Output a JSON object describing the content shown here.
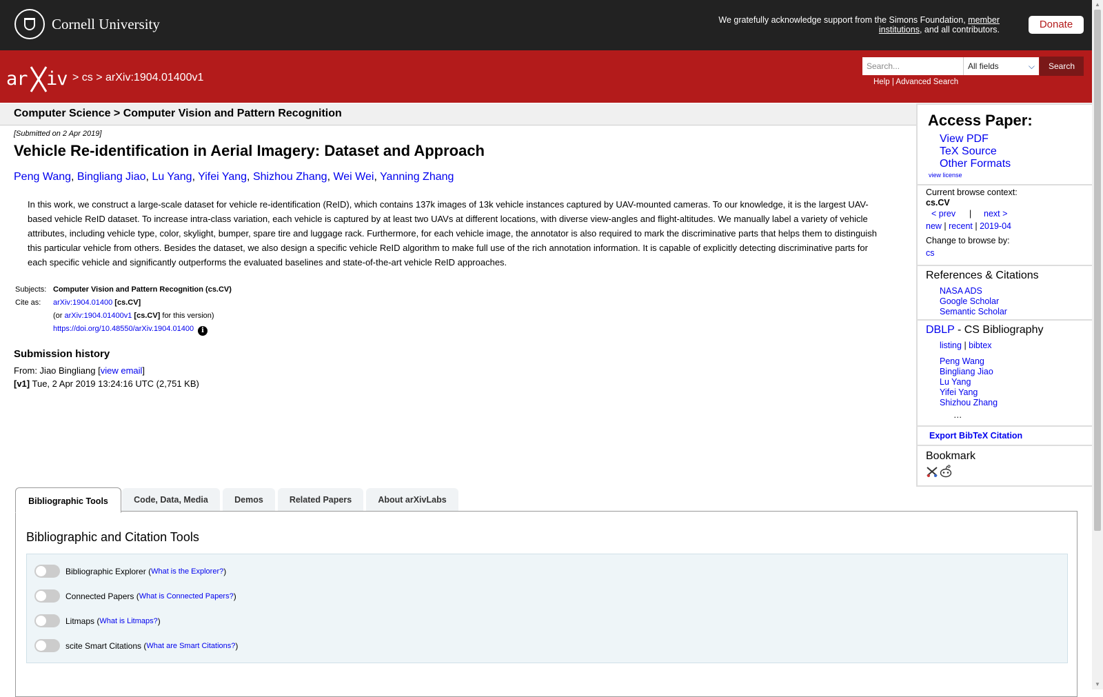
{
  "banner": {
    "university": "Cornell University",
    "ack_prefix": "We gratefully acknowledge support from the Simons Foundation, ",
    "ack_link": "member institutions",
    "ack_suffix": ", and all contributors.",
    "donate": "Donate"
  },
  "header": {
    "logo": "arXiv",
    "sep1": "> ",
    "crumb_cs": "cs",
    "sep2": " > ",
    "crumb_id": "arXiv:1904.01400v1",
    "search_placeholder": "Search...",
    "field_select": "All fields",
    "search_button": "Search",
    "help": "Help",
    "pipe": " | ",
    "advanced": "Advanced Search"
  },
  "subheader": "Computer Science > Computer Vision and Pattern Recognition",
  "paper": {
    "submitted": "[Submitted on 2 Apr 2019]",
    "title": "Vehicle Re-identification in Aerial Imagery: Dataset and Approach",
    "authors": [
      "Peng Wang",
      "Bingliang Jiao",
      "Lu Yang",
      "Yifei Yang",
      "Shizhou Zhang",
      "Wei Wei",
      "Yanning Zhang"
    ],
    "abstract": "In this work, we construct a large-scale dataset for vehicle re-identification (ReID), which contains 137k images of 13k vehicle instances captured by UAV-mounted cameras. To our knowledge, it is the largest UAV-based vehicle ReID dataset. To increase intra-class variation, each vehicle is captured by at least two UAVs at different locations, with diverse view-angles and flight-altitudes. We manually label a variety of vehicle attributes, including vehicle type, color, skylight, bumper, spare tire and luggage rack. Furthermore, for each vehicle image, the annotator is also required to mark the discriminative parts that helps them to distinguish this particular vehicle from others. Besides the dataset, we also design a specific vehicle ReID algorithm to make full use of the rich annotation information. It is capable of explicitly detecting discriminative parts for each specific vehicle and significantly outperforms the evaluated baselines and state-of-the-art vehicle ReID approaches."
  },
  "meta": {
    "subjects_label": "Subjects:",
    "subjects": "Computer Vision and Pattern Recognition (cs.CV)",
    "cite_label": "Cite as:",
    "cite_id": "arXiv:1904.01400",
    "cite_cat": " [cs.CV]",
    "or_prefix": "(or ",
    "version_id": "arXiv:1904.01400v1",
    "version_cat": " [cs.CV]",
    "version_suffix": " for this version)",
    "doi": "https://doi.org/10.48550/arXiv.1904.01400",
    "info_glyph": "i"
  },
  "history": {
    "title": "Submission history",
    "from_prefix": "From: Jiao Bingliang [",
    "view_email": "view email",
    "from_suffix": "]",
    "v1_label": "[v1]",
    "v1_text": " Tue, 2 Apr 2019 13:24:16 UTC (2,751 KB)"
  },
  "sidebar": {
    "access_title": "Access Paper:",
    "access_links": [
      "View PDF",
      "TeX Source",
      "Other Formats"
    ],
    "view_license": "view license",
    "context_label": "Current browse context:",
    "context_value": "cs.CV",
    "prev": "< prev",
    "bar": "|",
    "next": "next >",
    "new": "new",
    "recent": "recent",
    "month": "2019-04",
    "pipe": " | ",
    "change_label": "Change to browse by:",
    "change_cs": "cs",
    "refs_title": "References & Citations",
    "refs_links": [
      "NASA ADS",
      "Google Scholar",
      "Semantic Scholar"
    ],
    "dblp": "DBLP",
    "dblp_suffix": " - CS Bibliography",
    "listing": "listing",
    "bibtex": "bibtex",
    "dblp_authors": [
      "Peng Wang",
      "Bingliang Jiao",
      "Lu Yang",
      "Yifei Yang",
      "Shizhou Zhang"
    ],
    "ellipsis": "…",
    "export": "Export BibTeX Citation",
    "bookmark_title": "Bookmark"
  },
  "tabs": [
    "Bibliographic Tools",
    "Code, Data, Media",
    "Demos",
    "Related Papers",
    "About arXivLabs"
  ],
  "tools": {
    "heading": "Bibliographic and Citation Tools",
    "rows": [
      {
        "label": "Bibliographic Explorer",
        "link": "What is the Explorer?"
      },
      {
        "label": "Connected Papers",
        "link": "What is Connected Papers?"
      },
      {
        "label": "Litmaps",
        "link": "What is Litmaps?"
      },
      {
        "label": "scite Smart Citations",
        "link": "What are Smart Citations?"
      }
    ]
  },
  "colors": {
    "arxiv_red": "#b31b1b",
    "banner_dark": "#222222",
    "link_blue": "#0000ee"
  },
  "icons": [
    "cornell-seal-icon",
    "arxiv-logo-icon",
    "chevron-down-icon",
    "info-icon",
    "bibsonomy-icon",
    "reddit-icon"
  ]
}
